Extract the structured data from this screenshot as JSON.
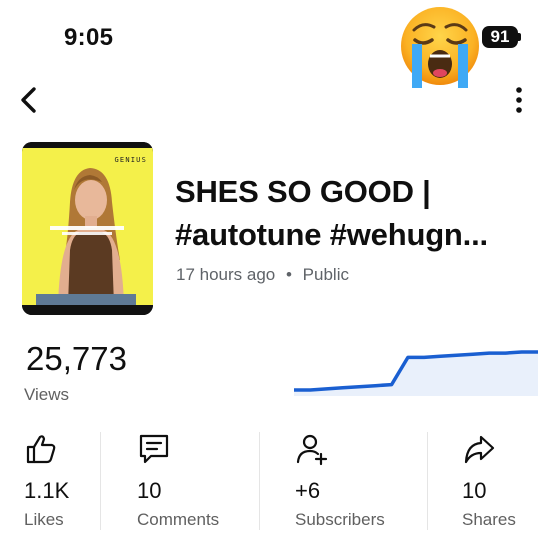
{
  "status_bar": {
    "time": "9:05",
    "battery": "91",
    "emoji": "loudly-crying-face"
  },
  "nav": {
    "back_icon": "chevron-left-icon",
    "more_icon": "vertical-dots-icon"
  },
  "video": {
    "title": "SHES SO GOOD |\n#autotune #wehugn...",
    "age": "17 hours ago",
    "separator": "•",
    "visibility": "Public",
    "thumbnail_brand": "GENIUS",
    "thumbnail_colors": {
      "background": "#f4f04a",
      "border": "#111111"
    }
  },
  "views": {
    "value": "25,773",
    "label": "Views"
  },
  "chart_data": {
    "type": "area",
    "title": "",
    "xlabel": "",
    "ylabel": "",
    "grid": false,
    "color": "#1a5fd1",
    "fill": "#e9f0fb",
    "series": [
      {
        "values": [
          0,
          0,
          1,
          2,
          3,
          4,
          5,
          30,
          30,
          31,
          32,
          33,
          34,
          34,
          35,
          35
        ]
      }
    ]
  },
  "stats": [
    {
      "icon": "thumbs-up-icon",
      "value": "1.1K",
      "label": "Likes"
    },
    {
      "icon": "comment-icon",
      "value": "10",
      "label": "Comments"
    },
    {
      "icon": "add-person-icon",
      "value": "+6",
      "label": "Subscribers"
    },
    {
      "icon": "share-arrow-icon",
      "value": "10",
      "label": "Shares"
    }
  ]
}
